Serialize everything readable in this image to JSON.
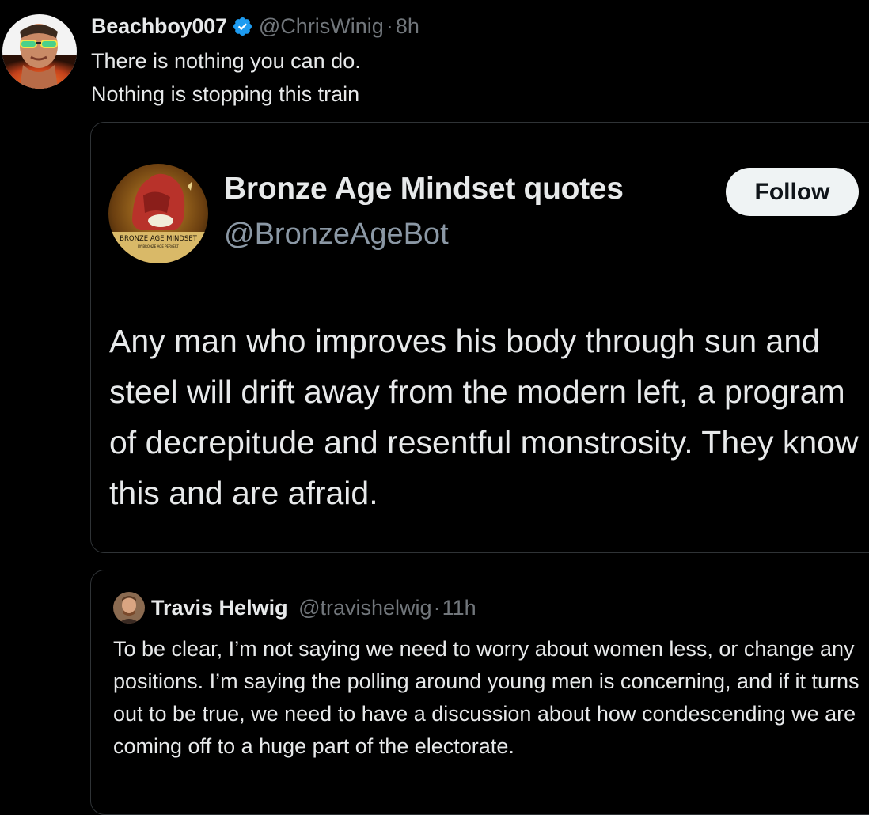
{
  "tweet": {
    "display_name": "Beachboy007",
    "handle": "@ChrisWinig",
    "separator": "·",
    "time": "8h",
    "lines": [
      "There is nothing you can do.",
      "Nothing is stopping this train"
    ]
  },
  "embedded_card": {
    "name": "Bronze Age Mindset quotes",
    "handle": "@BronzeAgeBot",
    "follow_label": "Follow",
    "avatar_text": "BRONZE AGE MINDSET",
    "avatar_subtext": "BY BRONZE AGE PERVERT",
    "quote_text": "Any man who improves his body through sun and steel will drift away from the modern left, a program of decrepitude and resentful monstrosity. They know this and are afraid."
  },
  "quoted_tweet": {
    "display_name": "Travis Helwig",
    "handle": "@travishelwig",
    "separator": "·",
    "time": "11h",
    "text": "To be clear, I’m not saying we need to worry about women less, or change any positions. I’m saying the polling around young men is concerning, and if it turns out to be true, we need to have a discussion about how condescending we are coming off to a huge part of the electorate."
  },
  "colors": {
    "background": "#000000",
    "text_primary": "#e7e9ea",
    "text_muted": "#71767b",
    "border": "#2f3336",
    "verified": "#1d9bf0",
    "follow_bg": "#eff3f4"
  },
  "icons": {
    "verified": "verified-badge-icon"
  }
}
